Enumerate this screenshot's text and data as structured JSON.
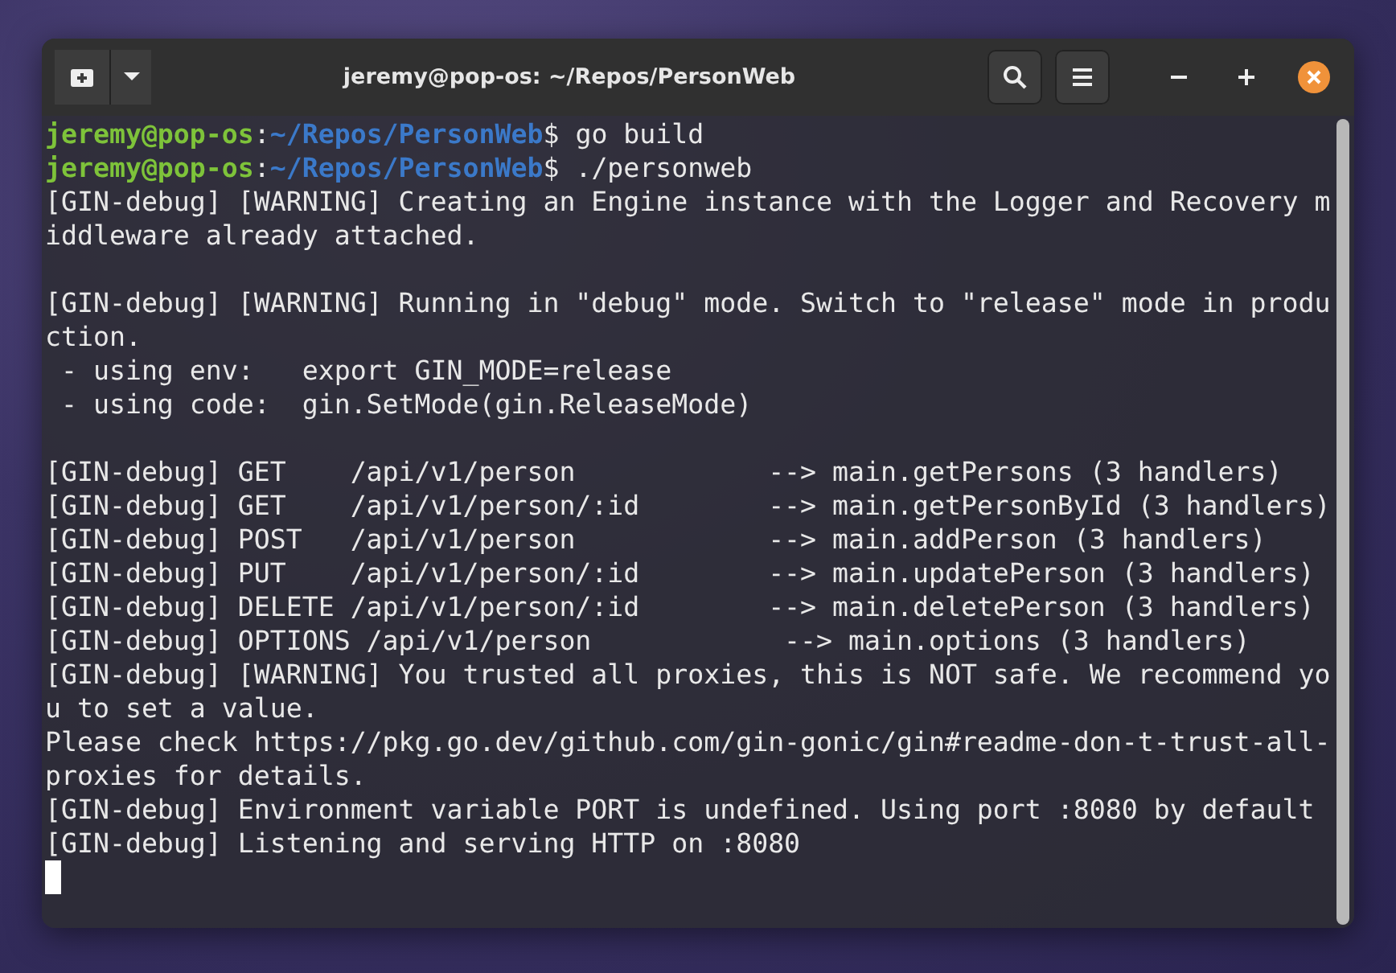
{
  "window": {
    "title": "jeremy@pop-os: ~/Repos/PersonWeb"
  },
  "terminal": {
    "lines": [
      {
        "kind": "prompt",
        "user": "jeremy@pop-os",
        "separator": ":",
        "path": "~/Repos/PersonWeb",
        "command": "$ go build"
      },
      {
        "kind": "prompt",
        "user": "jeremy@pop-os",
        "separator": ":",
        "path": "~/Repos/PersonWeb",
        "command": "$ ./personweb"
      },
      {
        "kind": "output",
        "text": "[GIN-debug] [WARNING] Creating an Engine instance with the Logger and Recovery m"
      },
      {
        "kind": "output",
        "text": "iddleware already attached."
      },
      {
        "kind": "blank"
      },
      {
        "kind": "output",
        "text": "[GIN-debug] [WARNING] Running in \"debug\" mode. Switch to \"release\" mode in produ"
      },
      {
        "kind": "output",
        "text": "ction."
      },
      {
        "kind": "output",
        "text": " - using env:   export GIN_MODE=release"
      },
      {
        "kind": "output",
        "text": " - using code:  gin.SetMode(gin.ReleaseMode)"
      },
      {
        "kind": "blank"
      },
      {
        "kind": "output",
        "text": "[GIN-debug] GET    /api/v1/person            --> main.getPersons (3 handlers)"
      },
      {
        "kind": "output",
        "text": "[GIN-debug] GET    /api/v1/person/:id        --> main.getPersonById (3 handlers)"
      },
      {
        "kind": "output",
        "text": "[GIN-debug] POST   /api/v1/person            --> main.addPerson (3 handlers)"
      },
      {
        "kind": "output",
        "text": "[GIN-debug] PUT    /api/v1/person/:id        --> main.updatePerson (3 handlers)"
      },
      {
        "kind": "output",
        "text": "[GIN-debug] DELETE /api/v1/person/:id        --> main.deletePerson (3 handlers)"
      },
      {
        "kind": "output",
        "text": "[GIN-debug] OPTIONS /api/v1/person            --> main.options (3 handlers)"
      },
      {
        "kind": "output",
        "text": "[GIN-debug] [WARNING] You trusted all proxies, this is NOT safe. We recommend yo"
      },
      {
        "kind": "output",
        "text": "u to set a value."
      },
      {
        "kind": "output",
        "text": "Please check https://pkg.go.dev/github.com/gin-gonic/gin#readme-don-t-trust-all-"
      },
      {
        "kind": "output",
        "text": "proxies for details."
      },
      {
        "kind": "output",
        "text": "[GIN-debug] Environment variable PORT is undefined. Using port :8080 by default"
      },
      {
        "kind": "output",
        "text": "[GIN-debug] Listening and serving HTTP on :8080"
      },
      {
        "kind": "cursor"
      }
    ]
  }
}
